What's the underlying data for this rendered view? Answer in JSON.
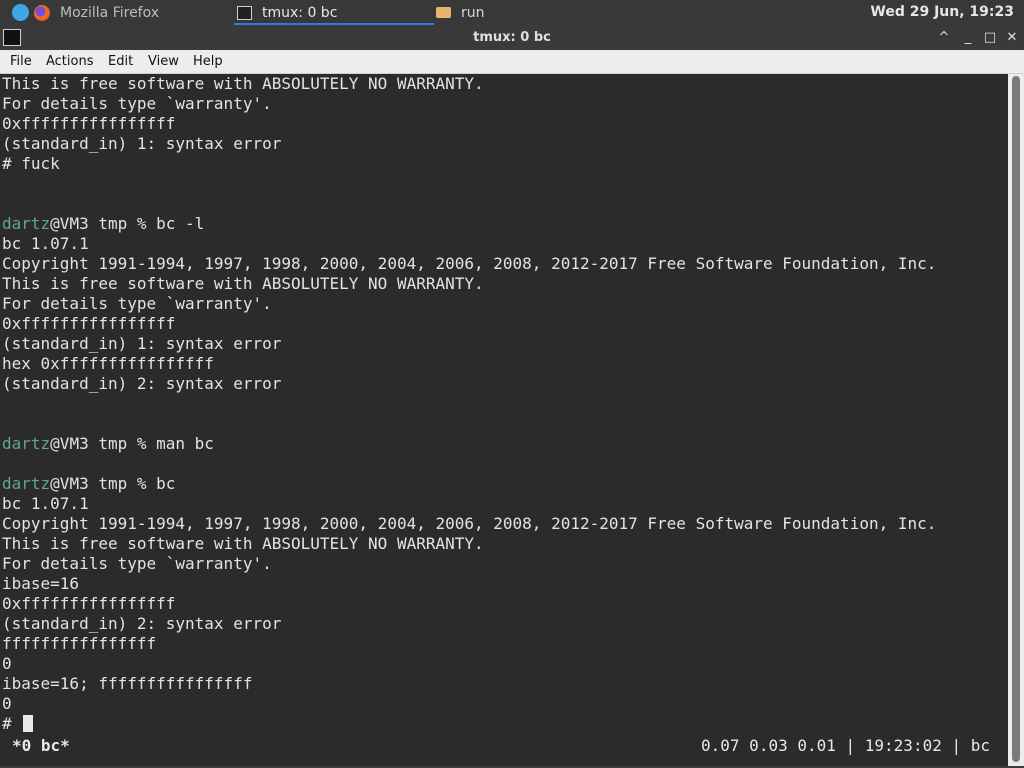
{
  "panel": {
    "tasks": [
      {
        "label": "Mozilla Firefox",
        "icon": "firefox-icon"
      },
      {
        "label": "tmux: 0 bc",
        "icon": "terminal-icon"
      },
      {
        "label": "run",
        "icon": "folder-icon"
      }
    ],
    "clock": "Wed 29 Jun, 19:23"
  },
  "window": {
    "title": "tmux: 0 bc",
    "controls": [
      "^",
      "_",
      "□",
      "✕"
    ]
  },
  "menu": [
    "File",
    "Actions",
    "Edit",
    "View",
    "Help"
  ],
  "terminal": {
    "lines": [
      "This is free software with ABSOLUTELY NO WARRANTY.",
      "For details type `warranty'.",
      "0xffffffffffffffff",
      "(standard_in) 1: syntax error",
      "# fuck",
      "",
      "",
      {
        "user": "dartz",
        "rest": "@VM3 tmp % bc -l"
      },
      "bc 1.07.1",
      "Copyright 1991-1994, 1997, 1998, 2000, 2004, 2006, 2008, 2012-2017 Free Software Foundation, Inc.",
      "This is free software with ABSOLUTELY NO WARRANTY.",
      "For details type `warranty'.",
      "0xffffffffffffffff",
      "(standard_in) 1: syntax error",
      "hex 0xffffffffffffffff",
      "(standard_in) 2: syntax error",
      "",
      "",
      {
        "user": "dartz",
        "rest": "@VM3 tmp % man bc"
      },
      "",
      {
        "user": "dartz",
        "rest": "@VM3 tmp % bc"
      },
      "bc 1.07.1",
      "Copyright 1991-1994, 1997, 1998, 2000, 2004, 2006, 2008, 2012-2017 Free Software Foundation, Inc.",
      "This is free software with ABSOLUTELY NO WARRANTY.",
      "For details type `warranty'.",
      "ibase=16",
      "0xffffffffffffffff",
      "(standard_in) 2: syntax error",
      "ffffffffffffffff",
      "0",
      "ibase=16; ffffffffffffffff",
      "0",
      "# "
    ]
  },
  "status": {
    "left": "*0 bc*",
    "right": "0.07 0.03 0.01 | 19:23:02 | bc"
  },
  "colors": {
    "terminal_bg": "#2b2b2b",
    "terminal_fg": "#e3e3e3",
    "prompt_user": "#5fa78f",
    "accent": "#2f7ce0"
  }
}
